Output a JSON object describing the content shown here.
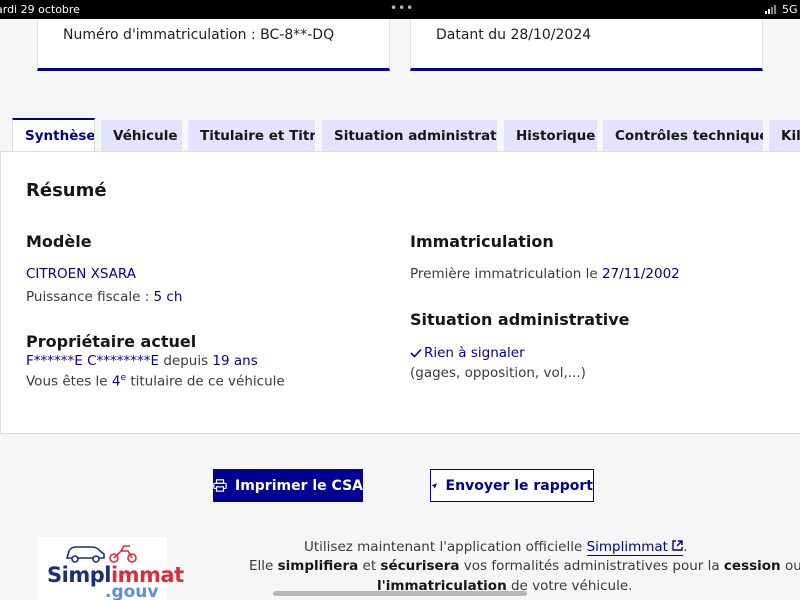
{
  "status_bar": {
    "time": "ardi 29 octobre",
    "network": "5G"
  },
  "top_cards": {
    "plate": "Numéro d'immatriculation : BC-8**-DQ",
    "date": "Datant du 28/10/2024"
  },
  "tabs": [
    {
      "label": "Synthèse",
      "active": true
    },
    {
      "label": "Véhicule"
    },
    {
      "label": "Titulaire et Titre"
    },
    {
      "label": "Situation administrative"
    },
    {
      "label": "Historique"
    },
    {
      "label": "Contrôles techniques"
    },
    {
      "label": "Kilo"
    }
  ],
  "summary": {
    "title": "Résumé",
    "model": {
      "heading": "Modèle",
      "name": "CITROEN XSARA",
      "fiscal_label": "Puissance fiscale : ",
      "fiscal_value": "5 ch"
    },
    "registration": {
      "heading": "Immatriculation",
      "first_label": "Première immatriculation le ",
      "first_date": "27/11/2002"
    },
    "owner": {
      "heading": "Propriétaire actuel",
      "name": "F******E C********E",
      "since_label": " depuis ",
      "since_value": "19 ans",
      "rank_prefix": "Vous êtes le ",
      "rank_number": "4",
      "rank_sup": "e",
      "rank_suffix": " titulaire de ce véhicule"
    },
    "situation": {
      "heading": "Situation administrative",
      "status": "Rien à signaler",
      "detail": "(gages, opposition, vol,...)"
    }
  },
  "buttons": {
    "print": "Imprimer le CSA",
    "send": "Envoyer le rapport"
  },
  "footer": {
    "logo_simpl": "Simpl",
    "logo_immat": "immat",
    "logo_gouv": ".gouv",
    "line1_prefix": "Utilisez maintenant l'application officielle ",
    "line1_link": "Simplimmat",
    "line1_suffix": ".",
    "line2_a": "Elle ",
    "line2_b": "simplifiera",
    "line2_c": " et ",
    "line2_d": "sécurisera",
    "line2_e": " vos formalités administratives pour la ",
    "line2_f": "cession",
    "line2_g": " ou",
    "line3_a": "l'immatriculation",
    "line3_b": " de votre véhicule."
  },
  "colors": {
    "primary": "#000091",
    "tab_bg": "#e3e3fd",
    "logo_red": "#d92d3d",
    "logo_navy": "#1a2f7a"
  }
}
